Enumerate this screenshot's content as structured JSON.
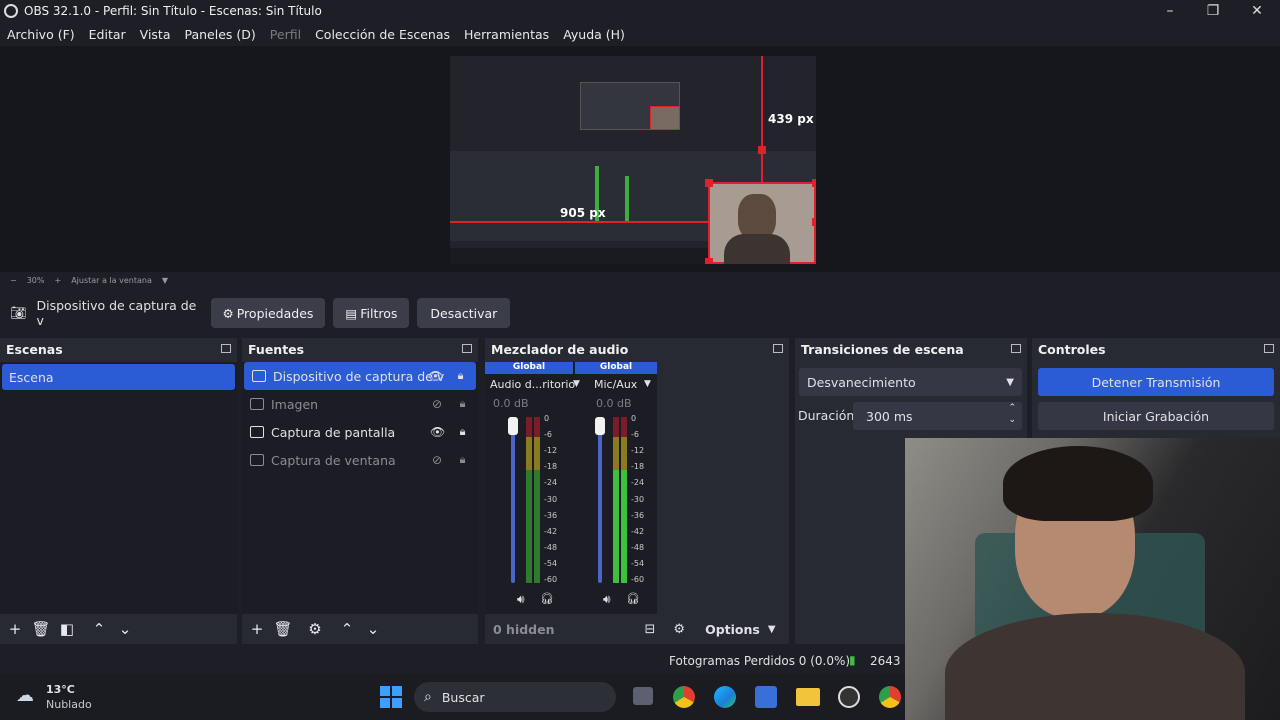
{
  "window": {
    "title": "OBS 32.1.0 - Perfil: Sin Título - Escenas: Sin Título"
  },
  "menu": [
    "Archivo (F)",
    "Editar",
    "Vista",
    "Paneles (D)",
    "Perfil",
    "Colección de Escenas",
    "Herramientas",
    "Ayuda (H)"
  ],
  "preview": {
    "width_label": "905 px",
    "height_label": "439 px"
  },
  "zoom": {
    "level": "30%",
    "fit_label": "Ajustar a la ventana"
  },
  "context_bar": {
    "source_name": "Dispositivo de captura de v",
    "properties": "Propiedades",
    "filters": "Filtros",
    "deactivate": "Desactivar"
  },
  "scenes": {
    "title": "Escenas",
    "items": [
      "Escena"
    ]
  },
  "sources": {
    "title": "Fuentes",
    "items": [
      {
        "label": "Dispositivo de captura de v",
        "visible": true,
        "selected": true
      },
      {
        "label": "Imagen",
        "visible": false,
        "selected": false
      },
      {
        "label": "Captura de pantalla",
        "visible": true,
        "selected": false
      },
      {
        "label": "Captura de ventana",
        "visible": false,
        "selected": false
      }
    ]
  },
  "mixer": {
    "title": "Mezclador de audio",
    "channels": [
      {
        "scope": "Global",
        "name": "Audio d...ritorio",
        "db": "0.0 dB"
      },
      {
        "scope": "Global",
        "name": "Mic/Aux",
        "db": "0.0 dB"
      }
    ],
    "ticks": [
      "0",
      "-6",
      "-12",
      "-18",
      "-24",
      "-30",
      "-36",
      "-42",
      "-48",
      "-54",
      "-60"
    ],
    "hidden_label": "0 hidden",
    "options_label": "Options"
  },
  "transitions": {
    "title": "Transiciones de escena",
    "selected": "Desvanecimiento",
    "duration_label": "Duración",
    "duration_value": "300 ms"
  },
  "controls": {
    "title": "Controles",
    "stop_stream": "Detener Transmisión",
    "start_recording": "Iniciar Grabación"
  },
  "status": {
    "dropped_frames": "Fotogramas Perdidos 0 (0.0%)",
    "bitrate": "2643 k"
  },
  "taskbar": {
    "weather_temp": "13°C",
    "weather_desc": "Nublado",
    "search": "Buscar"
  },
  "colors": {
    "accent": "#2c5bd6",
    "panel": "#272a33",
    "background": "#1e1f26",
    "selection_red": "#e0202a"
  }
}
